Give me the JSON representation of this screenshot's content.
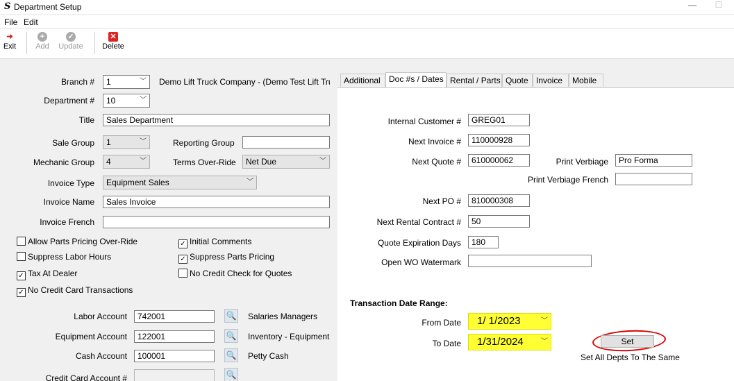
{
  "window": {
    "title": "Department Setup",
    "app_icon": "S",
    "minimize": "—",
    "maximize": "☐"
  },
  "menu": {
    "file": "File",
    "edit": "Edit"
  },
  "toolbar": {
    "exit": "Exit",
    "add": "Add",
    "update": "Update",
    "delete": "Delete"
  },
  "form": {
    "branch_label": "Branch #",
    "branch_value": "1",
    "branch_desc": "Demo Lift Truck Company - (Demo Test Lift Tru",
    "department_label": "Department #",
    "department_value": "10",
    "title_label": "Title",
    "title_value": "Sales Department",
    "sale_group_label": "Sale Group",
    "sale_group_value": "1",
    "reporting_group_label": "Reporting Group",
    "reporting_group_value": "",
    "mechanic_group_label": "Mechanic Group",
    "mechanic_group_value": "4",
    "terms_label": "Terms Over-Ride",
    "terms_value": "Net Due",
    "invoice_type_label": "Invoice Type",
    "invoice_type_value": "Equipment Sales",
    "invoice_name_label": "Invoice Name",
    "invoice_name_value": "Sales Invoice",
    "invoice_french_label": "Invoice French",
    "invoice_french_value": ""
  },
  "checkboxes": [
    {
      "label": "Allow Parts Pricing Over-Ride",
      "checked": false
    },
    {
      "label": "Initial Comments",
      "checked": true
    },
    {
      "label": "Suppress Labor Hours",
      "checked": false
    },
    {
      "label": "Suppress Parts Pricing",
      "checked": true
    },
    {
      "label": "Tax At Dealer",
      "checked": true
    },
    {
      "label": "No Credit Check for Quotes",
      "checked": false
    },
    {
      "label": "No Credit Card Transactions",
      "checked": true
    }
  ],
  "accounts": {
    "labor_label": "Labor Account",
    "labor_value": "742001",
    "labor_desc": "Salaries Managers",
    "equipment_label": "Equipment Account",
    "equipment_value": "122001",
    "equipment_desc": "Inventory - Equipment",
    "cash_label": "Cash Account",
    "cash_value": "100001",
    "cash_desc": "Petty Cash",
    "credit_card_label": "Credit Card Account #",
    "credit_card_value": ""
  },
  "tabs": [
    "Additional",
    "Doc #s / Dates",
    "Rental / Parts",
    "Quote",
    "Invoice",
    "Mobile"
  ],
  "active_tab": "Doc #s / Dates",
  "docs": {
    "internal_customer_label": "Internal Customer #",
    "internal_customer_value": "GREG01",
    "next_invoice_label": "Next Invoice #",
    "next_invoice_value": "110000928",
    "next_quote_label": "Next Quote #",
    "next_quote_value": "610000062",
    "print_verbiage_label": "Print Verbiage",
    "print_verbiage_value": "Pro Forma",
    "print_verbiage_french_label": "Print Verbiage French",
    "print_verbiage_french_value": "",
    "next_po_label": "Next PO #",
    "next_po_value": "810000308",
    "next_rental_label": "Next Rental Contract #",
    "next_rental_value": "50",
    "quote_exp_label": "Quote Expiration Days",
    "quote_exp_value": "180",
    "watermark_label": "Open WO Watermark",
    "watermark_value": ""
  },
  "date_range": {
    "heading": "Transaction Date Range:",
    "from_label": "From Date",
    "from_value": "1/  1/2023",
    "to_label": "To Date",
    "to_value": "1/31/2024",
    "set_button": "Set",
    "set_note": "Set All Depts To The Same"
  },
  "colors": {
    "highlight": "#ffff33",
    "annotation": "#dd0000",
    "exit_icon": "#cc2222",
    "delete_icon": "#dd2222"
  }
}
